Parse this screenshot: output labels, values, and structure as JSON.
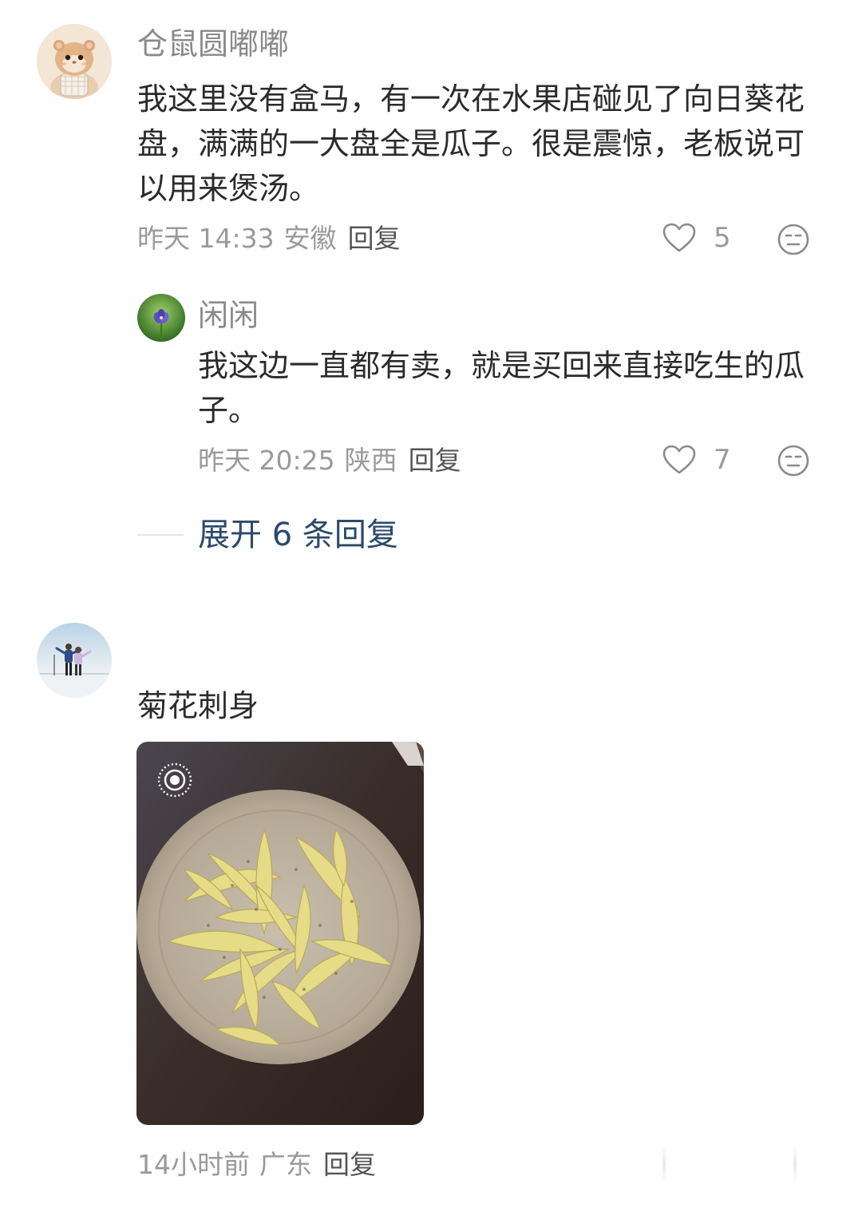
{
  "comments": [
    {
      "username": "仓鼠圆嘟嘟",
      "avatar_icon": "hamster-avatar",
      "text": "我这里没有盒马，有一次在水果店碰见了向日葵花盘，满满的一大盘全是瓜子。很是震惊，老板说可以用来煲汤。",
      "time": "昨天 14:33",
      "location": "安徽",
      "reply_label": "回复",
      "likes": "5",
      "replies": [
        {
          "username": "闲闲",
          "avatar_icon": "flower-avatar",
          "text": "我这边一直都有卖，就是买回来直接吃生的瓜子。",
          "time": "昨天 20:25",
          "location": "陕西",
          "reply_label": "回复",
          "likes": "7"
        }
      ],
      "expand_label": "展开 6 条回复"
    },
    {
      "username": "",
      "avatar_icon": "couple-snow-avatar",
      "text": "菊花刺身",
      "image_icon": "chrysanthemum-dish-photo",
      "live_badge_icon": "live-photo-icon",
      "time": "14小时前",
      "location": "广东",
      "reply_label": "回复"
    }
  ],
  "colors": {
    "username": "#8a8a8a",
    "meta": "#9a9a9a",
    "expand_link": "#2a4a6b",
    "body_text": "#2b2b2b"
  }
}
